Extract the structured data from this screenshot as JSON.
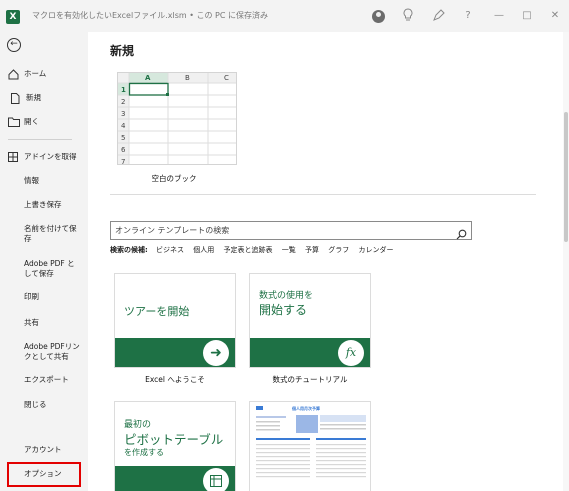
{
  "window": {
    "title": "マクロを有効化したいExcelファイル.xlsm • この PC に保存済み",
    "app_icon_letter": "X",
    "help": "?",
    "min": "—",
    "max": "□",
    "close": "✕"
  },
  "sidebar": {
    "items": [
      {
        "label": "ホーム"
      },
      {
        "label": "新規"
      },
      {
        "label": "開く"
      },
      {
        "label": "アドインを取得"
      },
      {
        "label": "情報"
      },
      {
        "label": "上書き保存"
      },
      {
        "label": "名前を付けて保存"
      },
      {
        "label": "Adobe PDF として保存"
      },
      {
        "label": "印刷"
      },
      {
        "label": "共有"
      },
      {
        "label": "Adobe PDFリンクとして共有"
      },
      {
        "label": "エクスポート"
      },
      {
        "label": "閉じる"
      },
      {
        "label": "アカウント"
      },
      {
        "label": "オプション"
      }
    ]
  },
  "main": {
    "title": "新規",
    "blank_workbook": {
      "label": "空白のブック",
      "columns": [
        "A",
        "B",
        "C"
      ],
      "rows": [
        "1",
        "2",
        "3",
        "4",
        "5",
        "6",
        "7"
      ]
    },
    "search": {
      "placeholder": "オンライン テンプレートの検索"
    },
    "suggestions": {
      "label": "検索の候補:",
      "items": [
        "ビジネス",
        "個人用",
        "予定表と追跡表",
        "一覧",
        "予算",
        "グラフ",
        "カレンダー"
      ]
    },
    "templates": [
      {
        "text": "ツアーを開始",
        "label": "Excel へようこそ"
      },
      {
        "text_line1": "数式の使用を",
        "text_line2": "開始する",
        "label": "数式のチュートリアル",
        "fx": "fx"
      },
      {
        "text_line1": "最初の",
        "text_line2": "ピボットテーブル",
        "text_line3": "を作成する"
      },
      {
        "thumb_title": "個人用月次予算"
      }
    ]
  },
  "colors": {
    "accent": "#1e7145",
    "highlight": "#e30000"
  }
}
